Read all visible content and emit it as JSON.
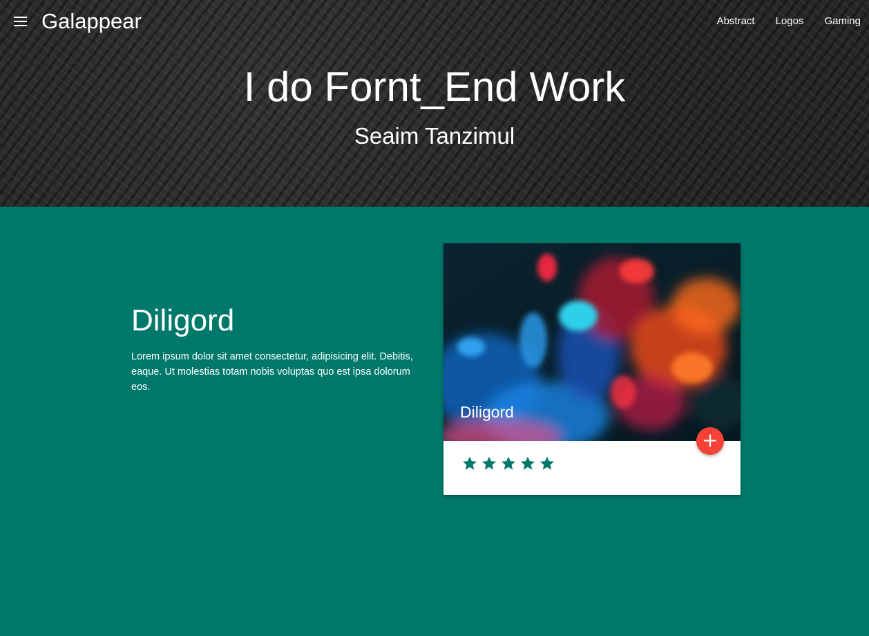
{
  "navbar": {
    "menu_icon": "menu-icon",
    "brand": "Galappear",
    "links": [
      {
        "label": "Abstract"
      },
      {
        "label": "Logos"
      },
      {
        "label": "Gaming"
      }
    ]
  },
  "hero": {
    "title": "I do Fornt_End Work",
    "subtitle": "Seaim Tanzimul"
  },
  "section": {
    "title": "Diligord",
    "text": "Lorem ipsum dolor sit amet consectetur, adipisicing elit. Debitis, eaque. Ut molestias totam nobis voluptas quo est ipsa dolorum eos."
  },
  "card": {
    "title": "Diligord",
    "fab_icon": "plus-icon",
    "fab_symbol": "+",
    "rating": 5,
    "rating_max": 5,
    "star_icon": "star-icon"
  },
  "colors": {
    "teal": "#00796b",
    "fab_red": "#f44336",
    "header_dark": "#2a2a2a",
    "white": "#ffffff"
  }
}
